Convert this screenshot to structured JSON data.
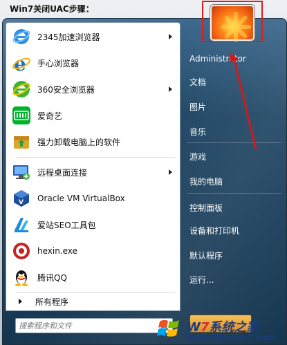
{
  "caption": "Win7关闭UAC步骤：",
  "programs": [
    {
      "label": "2345加速浏览器",
      "icon": "ie-blue-icon",
      "has_submenu": true
    },
    {
      "label": "手心浏览器",
      "icon": "ie-blue-icon",
      "has_submenu": false
    },
    {
      "label": "360安全浏览器",
      "icon": "360-browser-icon",
      "has_submenu": true
    },
    {
      "label": "爱奇艺",
      "icon": "iqiyi-icon",
      "has_submenu": false
    },
    {
      "label": "强力卸载电脑上的软件",
      "icon": "uninstall-icon",
      "has_submenu": false
    },
    {
      "label": "远程桌面连接",
      "icon": "remote-desktop-icon",
      "has_submenu": true
    },
    {
      "label": "Oracle VM VirtualBox",
      "icon": "virtualbox-icon",
      "has_submenu": false
    },
    {
      "label": "爱站SEO工具包",
      "icon": "aizhan-icon",
      "has_submenu": false
    },
    {
      "label": "hexin.exe",
      "icon": "hexin-icon",
      "has_submenu": false
    },
    {
      "label": "腾讯QQ",
      "icon": "qq-icon",
      "has_submenu": false
    }
  ],
  "all_programs": "所有程序",
  "search": {
    "placeholder": "搜索程序和文件"
  },
  "right_links": [
    {
      "label": "Administrator"
    },
    {
      "label": "文档"
    },
    {
      "label": "图片"
    },
    {
      "label": "音乐"
    },
    {
      "label": "游戏"
    },
    {
      "label": "我的电脑"
    },
    {
      "label": "控制面板"
    },
    {
      "label": "设备和打印机"
    },
    {
      "label": "默认程序"
    },
    {
      "label": "运行..."
    }
  ],
  "watermark": {
    "brand_w": "W",
    "brand_7": "7",
    "brand_rest": "系统之家",
    "url": "Www.Winwin7.com"
  },
  "colors": {
    "highlight_box": "#e11b1b",
    "arrow": "#d31a1a",
    "menu_dark": "#163650"
  }
}
